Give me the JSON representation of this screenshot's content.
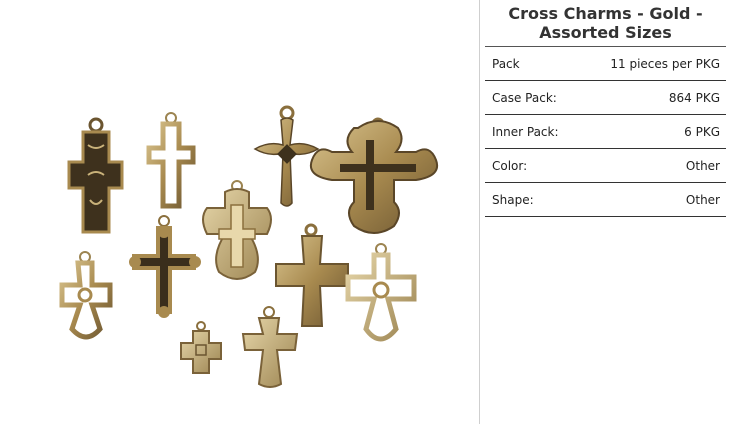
{
  "product": {
    "title_line1": "Cross Charms - Gold -",
    "title_line2": "Assorted Sizes",
    "image_alt": "Assorted gold cross charms"
  },
  "specs": [
    {
      "label": "Pack",
      "value": "11 pieces per PKG"
    },
    {
      "label": "Case Pack:",
      "value": "864 PKG"
    },
    {
      "label": "Inner Pack:",
      "value": "6 PKG"
    },
    {
      "label": "Color:",
      "value": "Other"
    },
    {
      "label": "Shape:",
      "value": "Other"
    }
  ],
  "colors": {
    "gold": "#b89a5e",
    "gold_dark": "#6e5a32",
    "antique": "#3a2e1c"
  }
}
